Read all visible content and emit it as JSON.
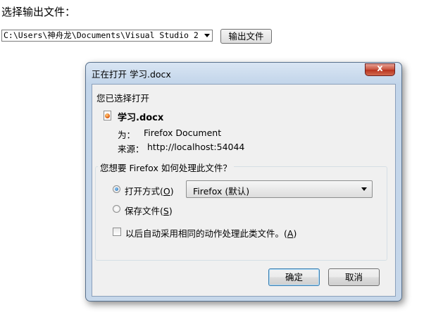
{
  "page": {
    "label": "选择输出文件：",
    "path_value": "C:\\Users\\神舟龙\\Documents\\Visual Studio 2",
    "output_button": "输出文件"
  },
  "dialog": {
    "title": "正在打开 学习.docx",
    "intro": "您已选择打开",
    "file_name": "学习.docx",
    "type_label": "为：",
    "type_value": "Firefox Document",
    "source_label": "来源：",
    "source_value": "http://localhost:54044",
    "question": "您想要 Firefox 如何处理此文件？",
    "open_with": {
      "label": "打开方式(",
      "key": "O",
      "suffix": ")",
      "selected": true
    },
    "app_select_value": "Firefox (默认)",
    "save_file": {
      "label": "保存文件(",
      "key": "S",
      "suffix": ")",
      "selected": false
    },
    "auto_action": {
      "label": "以后自动采用相同的动作处理此类文件。(",
      "key": "A",
      "suffix": ")",
      "checked": false
    },
    "ok_button": "确定",
    "cancel_button": "取消",
    "close_glyph": "x"
  },
  "icons": {
    "file": "firefox-document-icon",
    "close": "close-icon"
  },
  "colors": {
    "titlebar": "#c8d9ee",
    "close_button": "#c7503a",
    "default_button_border": "#3c7fb1"
  }
}
